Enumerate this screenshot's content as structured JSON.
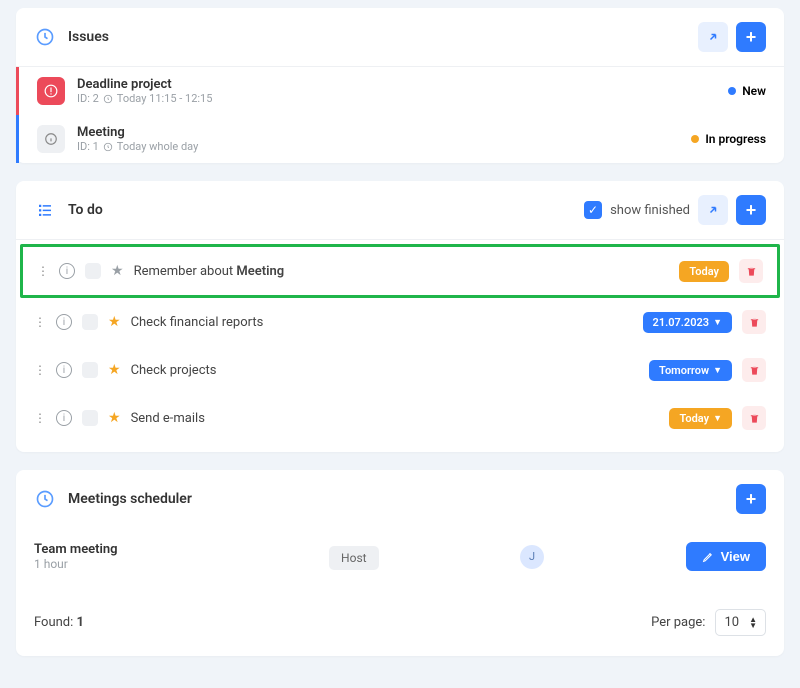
{
  "issues": {
    "title": "Issues",
    "items": [
      {
        "title": "Deadline project",
        "id_label": "ID: 2",
        "time": "Today 11:15 - 12:15",
        "status": "New",
        "dot": "blue",
        "variant": "red"
      },
      {
        "title": "Meeting",
        "id_label": "ID: 1",
        "time": "Today whole day",
        "status": "In progress",
        "dot": "orange",
        "variant": "gray"
      }
    ]
  },
  "todo": {
    "title": "To do",
    "show_finished_label": "show finished",
    "items": [
      {
        "text_prefix": "Remember about ",
        "text_bold": "Meeting",
        "text_suffix": "",
        "badge_text": "Today",
        "badge_color": "orange",
        "badge_caret": false,
        "starred": false,
        "highlight": true
      },
      {
        "text_prefix": "Check financial reports",
        "text_bold": "",
        "text_suffix": "",
        "badge_text": "21.07.2023",
        "badge_color": "blue",
        "badge_caret": true,
        "starred": true,
        "highlight": false
      },
      {
        "text_prefix": "Check projects",
        "text_bold": "",
        "text_suffix": "",
        "badge_text": "Tomorrow",
        "badge_color": "blue",
        "badge_caret": true,
        "starred": true,
        "highlight": false
      },
      {
        "text_prefix": "Send e-mails",
        "text_bold": "",
        "text_suffix": "",
        "badge_text": "Today",
        "badge_color": "orange",
        "badge_caret": true,
        "starred": true,
        "highlight": false
      }
    ]
  },
  "meetings": {
    "title": "Meetings scheduler",
    "item": {
      "title": "Team meeting",
      "duration": "1 hour",
      "host_label": "Host",
      "avatar_initial": "J",
      "view_label": "View"
    },
    "found_label": "Found:",
    "found_count": "1",
    "per_page_label": "Per page:",
    "per_page_value": "10"
  }
}
